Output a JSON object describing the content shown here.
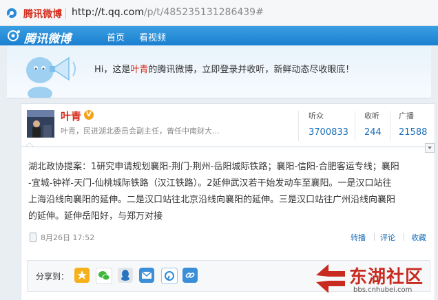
{
  "browser": {
    "site_name": "腾讯微博",
    "url_host": "http://t.qq.com",
    "url_path": "/p/t/485235131286439#"
  },
  "nav": {
    "logo_text": "腾讯微博",
    "items": [
      "首页",
      "看视频"
    ]
  },
  "banner": {
    "prefix": "Hi，这是",
    "highlight": "叶青",
    "suffix": "的腾讯微博，立即登录并收听，新鲜动态尽收眼底！"
  },
  "profile": {
    "name": "叶青",
    "bio": "叶青，民进湖北委员会副主任，曾任中南财大...",
    "stats": [
      {
        "label": "听众",
        "value": "3700833"
      },
      {
        "label": "收听",
        "value": "244"
      },
      {
        "label": "广播",
        "value": "21588"
      }
    ]
  },
  "post": {
    "lines": [
      "湖北政协提案：1研究申请规划襄阳-荆门-荆州-岳阳城际铁路；襄阳-信阳-合肥客运专线；襄阳",
      "-宜城-钟祥-天门-仙桃城际铁路（汉江铁路）。2延伸武汉若干始发动车至襄阳。一是汉口站往",
      "上海沿线向襄阳的延伸。二是汉口站往北京沿线向襄阳的延伸。三是汉口站往广州沿线向襄阳",
      "的延伸。延伸岳阳好，与郑万对接"
    ],
    "time": "8月26日 17:52",
    "actions": [
      "转播",
      "评论",
      "收藏"
    ]
  },
  "share": {
    "label": "分享到：",
    "targets": [
      "qzone-icon",
      "wechat-icon",
      "qq-icon",
      "email-icon",
      "weibo-icon",
      "link-icon"
    ]
  },
  "watermark": {
    "text": "东湖社区",
    "url": "bbs.cnhubei.com"
  },
  "colors": {
    "brand_red": "#d42e1e",
    "nav_blue": "#1a7fcf",
    "link_blue": "#1b6fb8"
  }
}
